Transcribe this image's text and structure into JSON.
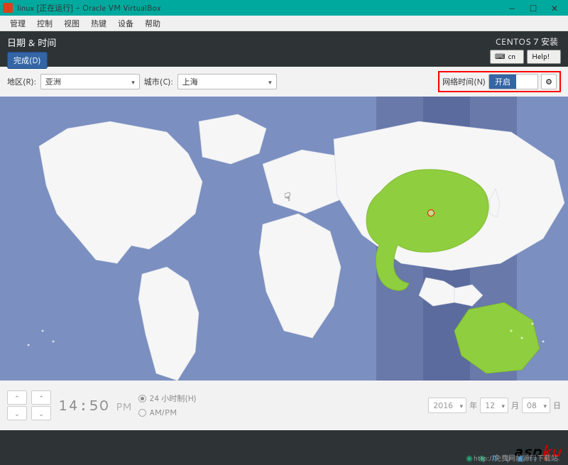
{
  "virtualbox": {
    "title": "linux [正在运行] - Oracle VM VirtualBox",
    "menu": {
      "manage": "管理",
      "control": "控制",
      "view": "视图",
      "hotkey": "热键",
      "device": "设备",
      "help": "帮助"
    },
    "win": {
      "min": "—",
      "max": "☐",
      "close": "✕"
    }
  },
  "header": {
    "title": "日期 & 时间",
    "done": "完成(D)",
    "install_label": "CENTOS 7 安装",
    "kb_layout": "cn",
    "help": "Help!"
  },
  "selectors": {
    "region_label": "地区(R):",
    "region_value": "亚洲",
    "city_label": "城市(C):",
    "city_value": "上海",
    "network_time_label": "网络时间(N)",
    "toggle_on": "开启"
  },
  "time": {
    "hour": "14",
    "minute": "50",
    "ampm": "PM",
    "fmt24": "24 小时制(H)",
    "fmt12": "AM/PM"
  },
  "date": {
    "year": "2016",
    "year_unit": "年",
    "month": "12",
    "month_unit": "月",
    "day": "08",
    "day_unit": "日"
  },
  "watermark": {
    "brand_a": "asp",
    "brand_b": "ku",
    "sub": "http://免费网站源码下载站"
  }
}
